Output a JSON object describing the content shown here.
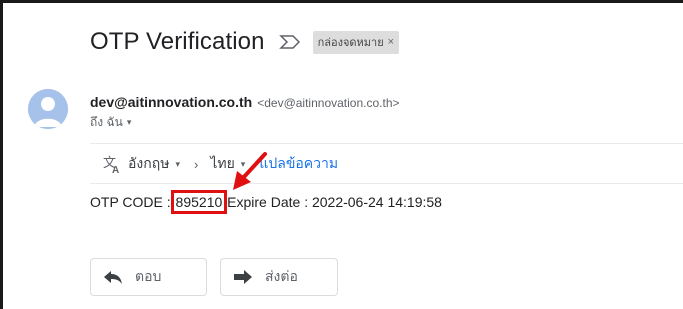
{
  "email": {
    "subject": "OTP Verification",
    "label": "กล่องจดหมาย",
    "label_close": "×",
    "sender_name": "dev@aitinnovation.co.th",
    "sender_email": "<dev@aitinnovation.co.th>",
    "to_text": "ถึง ฉัน",
    "to_caret": "▾"
  },
  "translate": {
    "source_lang": "อังกฤษ",
    "target_lang": "ไทย",
    "caret": "▾",
    "separator": "›",
    "action_label": "แปลข้อความ"
  },
  "body": {
    "otp_label": "OTP CODE : ",
    "otp_code": "895210",
    "expire_text": " Expire Date : 2022-06-24 14:19:58"
  },
  "actions": {
    "reply_label": "ตอบ",
    "forward_label": "ส่งต่อ"
  },
  "colors": {
    "link": "#1a73e8",
    "highlight": "#e01010",
    "avatar": "#a6c1ea"
  },
  "icons": [
    "important-marker-icon",
    "translate-icon",
    "reply-icon",
    "forward-icon",
    "red-arrow-annotation"
  ]
}
